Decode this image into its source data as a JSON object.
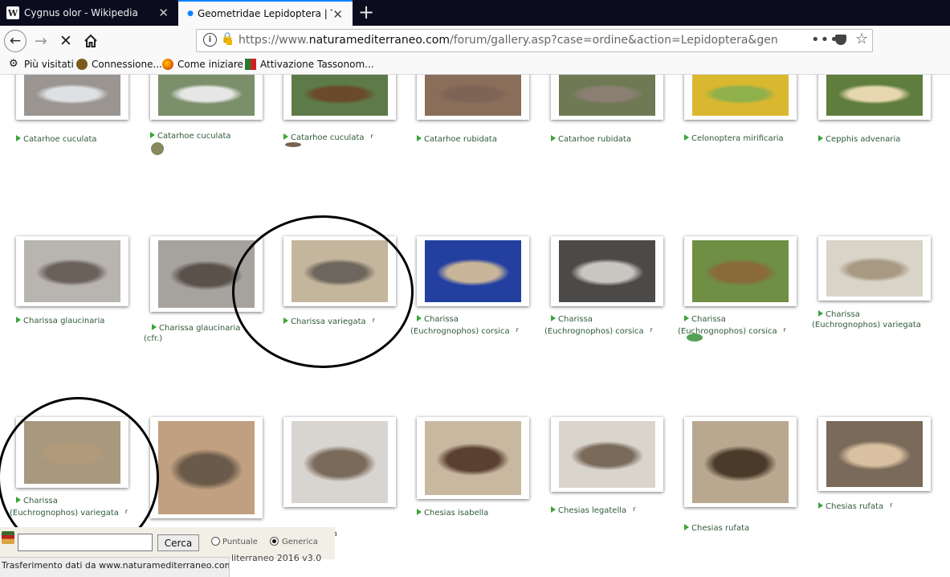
{
  "tabs": [
    {
      "title": "Cygnus olor - Wikipedia",
      "icon": "wikipedia-icon",
      "active": false
    },
    {
      "title": "Geometridae Lepidoptera | Tas",
      "icon": "loading-dot-icon",
      "active": true
    }
  ],
  "url": {
    "prefix": "https://www.",
    "domain": "naturamediterraneo.com",
    "rest": "/forum/gallery.asp?case=ordine&action=Lepidoptera&genere=Geometridae"
  },
  "bookmarks": [
    {
      "label": "Più visitati",
      "icon": "gear-icon"
    },
    {
      "label": "Connessione...",
      "icon": "leaf-icon"
    },
    {
      "label": "Come iniziare",
      "icon": "firefox-icon"
    },
    {
      "label": "Attivazione Tassonom...",
      "icon": "flag-icon"
    }
  ],
  "gallery": {
    "rows": [
      [
        {
          "caption": [
            "Catarhoe cuculata"
          ],
          "r": false
        },
        {
          "caption": [
            "Catarhoe cuculata"
          ],
          "r": false
        },
        {
          "caption": [
            "Catarhoe cuculata"
          ],
          "r": true
        },
        {
          "caption": [
            "Catarhoe rubidata"
          ],
          "r": false
        },
        {
          "caption": [
            "Catarhoe rubidata"
          ],
          "r": false
        },
        {
          "caption": [
            "Celonoptera mirificaria"
          ],
          "r": false
        },
        {
          "caption": [
            "Cepphis advenaria"
          ],
          "r": false
        }
      ],
      [
        {
          "caption": [
            "Charissa glaucinaria"
          ],
          "r": false
        },
        {
          "caption": [
            "Charissa glaucinaria",
            "(cfr.)"
          ],
          "r": false
        },
        {
          "caption": [
            "Charissa variegata"
          ],
          "r": true
        },
        {
          "caption": [
            "Charissa",
            "(Euchrognophos) corsica"
          ],
          "r": true
        },
        {
          "caption": [
            "Charissa",
            "(Euchrognophos) corsica"
          ],
          "r": true
        },
        {
          "caption": [
            "Charissa",
            "(Euchrognophos) corsica"
          ],
          "r": true
        },
        {
          "caption": [
            "Charissa",
            "(Euchrognophos) variegata"
          ],
          "r": false
        }
      ],
      [
        {
          "caption": [
            "Charissa",
            "(Euchrognophos) variegata"
          ],
          "r": true
        },
        {
          "caption": [
            ""
          ],
          "r": false
        },
        {
          "caption": [
            "caliginearia"
          ],
          "r": false
        },
        {
          "caption": [
            "Chesias isabella"
          ],
          "r": false
        },
        {
          "caption": [
            "Chesias legatella"
          ],
          "r": true
        },
        {
          "caption": [
            "Chesias rufata"
          ],
          "r": false
        },
        {
          "caption": [
            "Chesias rufata"
          ],
          "r": true
        }
      ]
    ],
    "r_label": "r"
  },
  "search": {
    "button": "Cerca",
    "option_1": "Puntuale",
    "option_2": "Generica",
    "selected": "Generica",
    "copyright": "literraneo 2016 v3.0"
  },
  "status": "Trasferimento dati da www.naturamediterraneo.com...",
  "colors": {
    "accent": "#0a84ff",
    "link_arrow": "#3aa53a",
    "caption": "#2f5a3a"
  }
}
